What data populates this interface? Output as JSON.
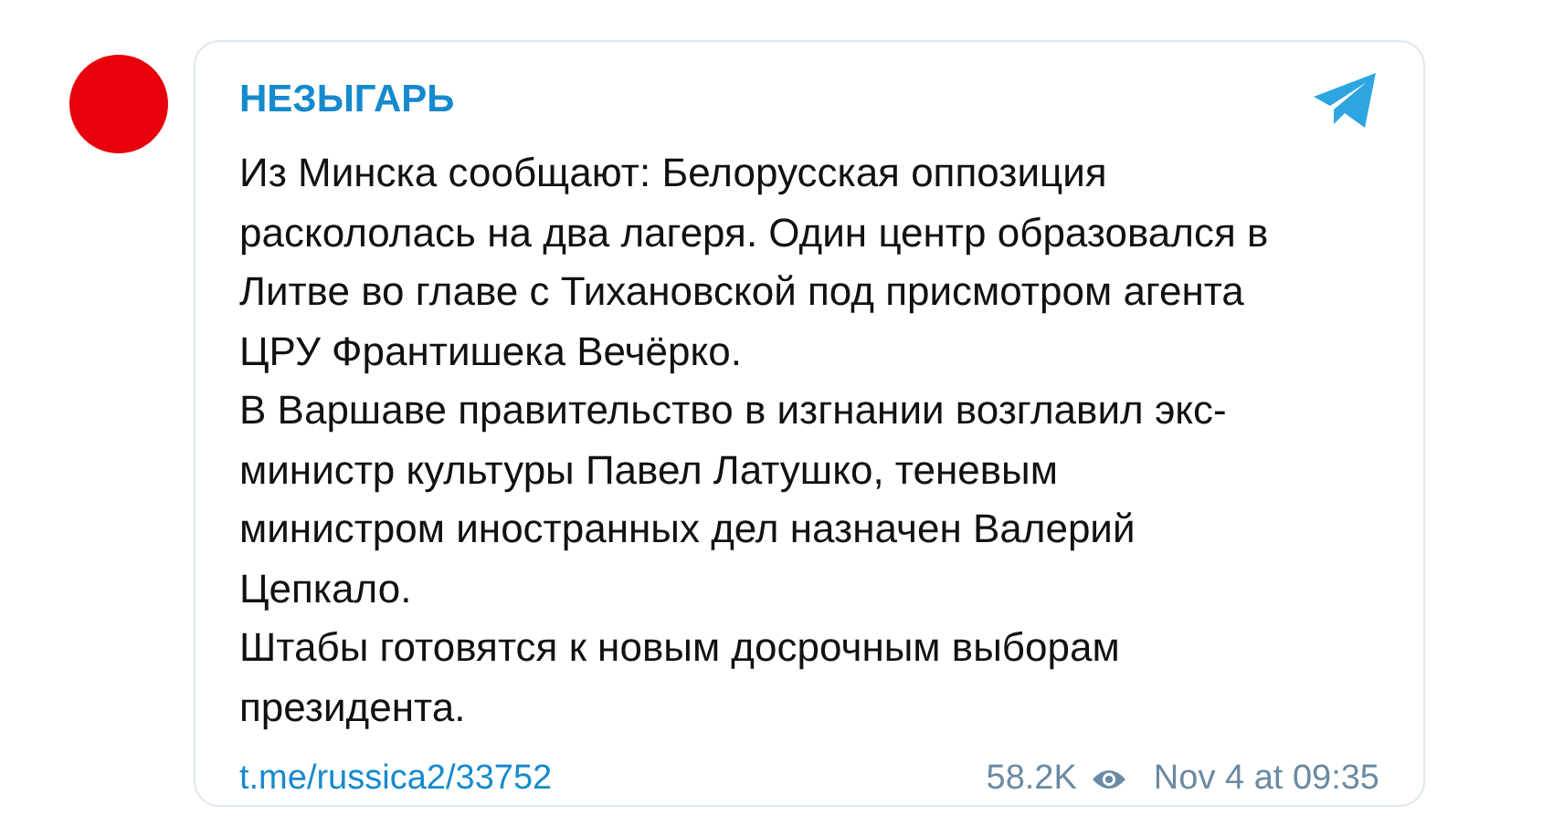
{
  "post": {
    "channel": "НЕЗЫГАРЬ",
    "paragraphs": [
      {
        "lines": [
          "Из Минска сообщают: Белорусская оппозиция",
          "раскололась на два лагеря. Один центр образовался в",
          "Литве во главе с Тихановской под присмотром агента",
          "ЦРУ Франтишека Вечёрко."
        ]
      },
      {
        "lines": [
          "В Варшаве правительство в изгнании возглавил экс-",
          "министр культуры Павел Латушко, теневым",
          "министром иностранных дел назначен Валерий",
          "Цепкало."
        ]
      },
      {
        "lines": [
          "Штабы готовятся к новым досрочным выборам",
          "президента."
        ]
      }
    ],
    "link": "t.me/russica2/33752",
    "views": "58.2K",
    "date": "Nov 4 at 09:35"
  }
}
